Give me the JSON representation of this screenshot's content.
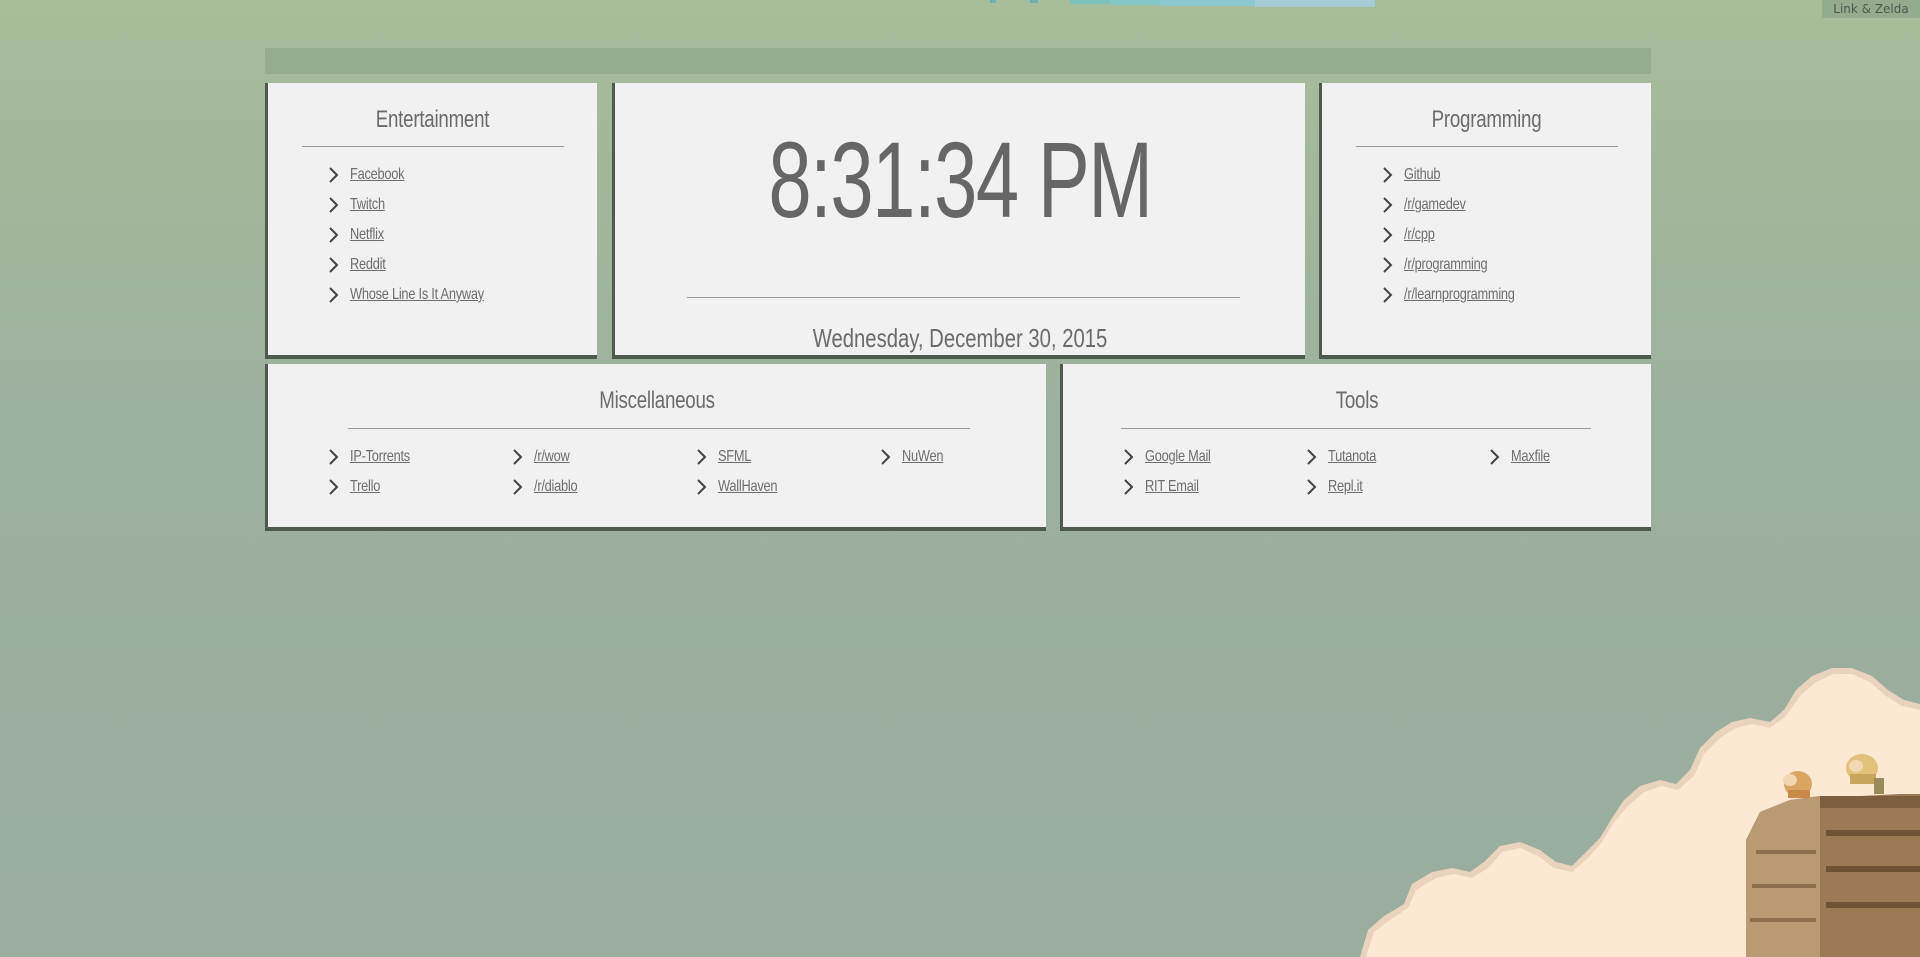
{
  "credit": "Link & Zelda",
  "clock": {
    "time": "8:31:34 PM",
    "date": "Wednesday, December 30, 2015"
  },
  "entertainment": {
    "title": "Entertainment",
    "links": [
      "Facebook",
      "Twitch",
      "Netflix",
      "Reddit",
      "Whose Line Is It Anyway"
    ]
  },
  "programming": {
    "title": "Programming",
    "links": [
      "Github",
      "/r/gamedev",
      "/r/cpp",
      "/r/programming",
      "/r/learnprogramming"
    ]
  },
  "miscellaneous": {
    "title": "Miscellaneous",
    "links": [
      "IP-Torrents",
      "/r/wow",
      "SFML",
      "NuWen",
      "Trello",
      "/r/diablo",
      "WallHaven"
    ]
  },
  "tools": {
    "title": "Tools",
    "links": [
      "Google Mail",
      "Tutanota",
      "Maxfile",
      "RIT Email",
      "Repl.it"
    ]
  },
  "icons": {
    "link_marker": "chevron-right-icon"
  },
  "colors": {
    "background": "#a2b79a",
    "panel": "#f1f1f1",
    "panel_shadow": "#4f5a4f",
    "text": "#666666",
    "topbar": "#95ac8d",
    "cloud": "#fde9d3"
  }
}
